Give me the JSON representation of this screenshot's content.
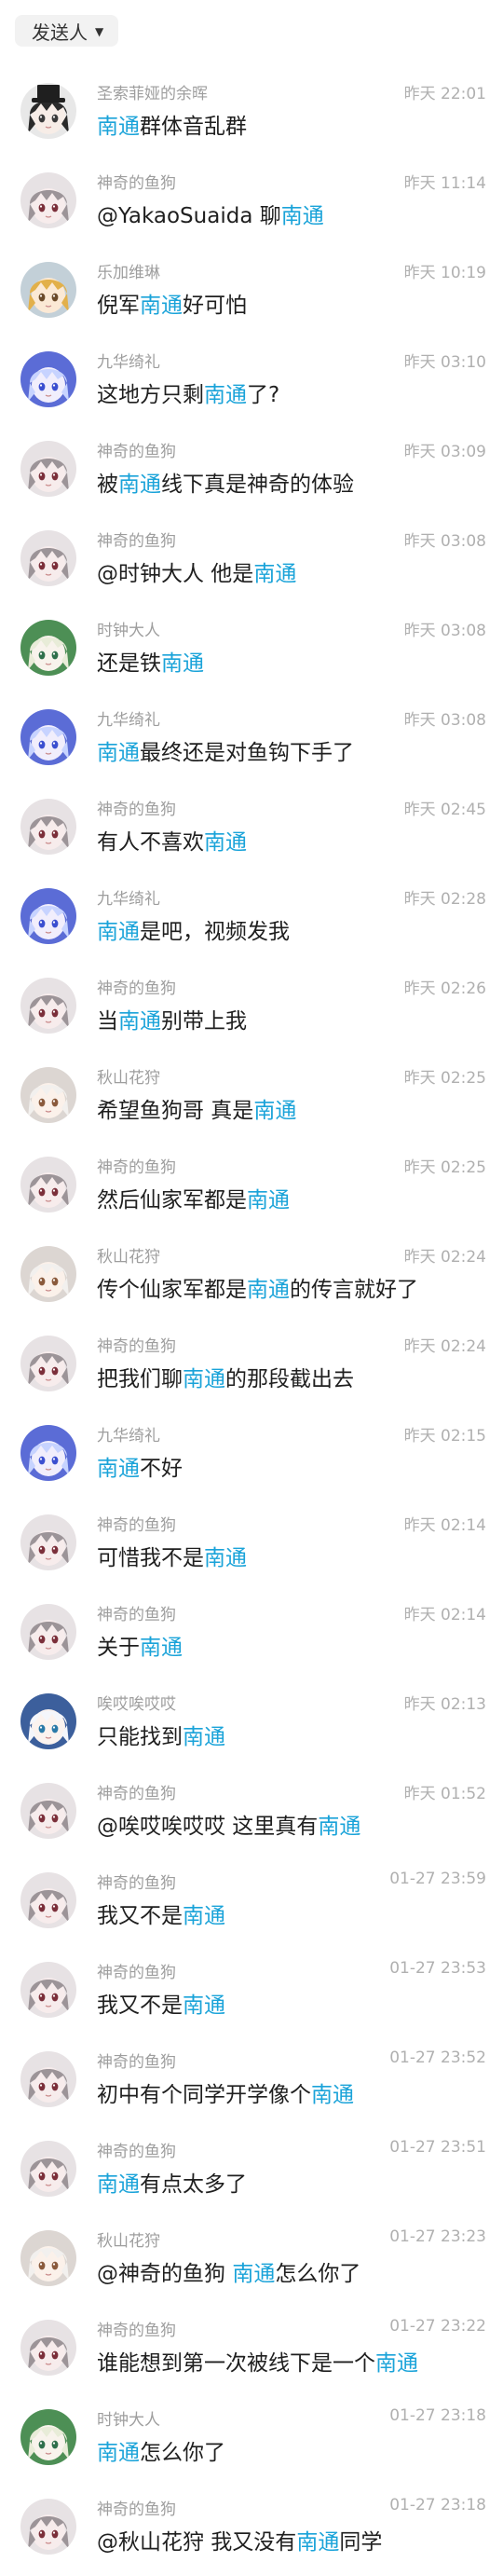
{
  "filter": {
    "label": "发送人",
    "icon": "caret-down-icon"
  },
  "highlight_color": "#1aa3d9",
  "messages": [
    {
      "sender": "圣索菲娅的余晖",
      "time": "昨天 22:01",
      "avatar": "dark",
      "parts": [
        {
          "t": "南通",
          "hl": true
        },
        {
          "t": "群体音乱群"
        }
      ]
    },
    {
      "sender": "神奇的鱼狗",
      "time": "昨天 11:14",
      "avatar": "gray",
      "parts": [
        {
          "t": "@YakaoSuaida 聊"
        },
        {
          "t": "南通",
          "hl": true
        }
      ]
    },
    {
      "sender": "乐加维琳",
      "time": "昨天 10:19",
      "avatar": "gold",
      "parts": [
        {
          "t": "倪军"
        },
        {
          "t": "南通",
          "hl": true
        },
        {
          "t": "好可怕"
        }
      ]
    },
    {
      "sender": "九华绮礼",
      "time": "昨天 03:10",
      "avatar": "blue",
      "parts": [
        {
          "t": "这地方只剩"
        },
        {
          "t": "南通",
          "hl": true
        },
        {
          "t": "了?"
        }
      ]
    },
    {
      "sender": "神奇的鱼狗",
      "time": "昨天 03:09",
      "avatar": "gray",
      "parts": [
        {
          "t": "被"
        },
        {
          "t": "南通",
          "hl": true
        },
        {
          "t": "线下真是神奇的体验"
        }
      ]
    },
    {
      "sender": "神奇的鱼狗",
      "time": "昨天 03:08",
      "avatar": "gray",
      "parts": [
        {
          "t": "@时钟大人 他是"
        },
        {
          "t": "南通",
          "hl": true
        }
      ]
    },
    {
      "sender": "时钟大人",
      "time": "昨天 03:08",
      "avatar": "green",
      "parts": [
        {
          "t": "还是铁"
        },
        {
          "t": "南通",
          "hl": true
        }
      ]
    },
    {
      "sender": "九华绮礼",
      "time": "昨天 03:08",
      "avatar": "blue",
      "parts": [
        {
          "t": "南通",
          "hl": true
        },
        {
          "t": "最终还是对鱼钩下手了"
        }
      ]
    },
    {
      "sender": "神奇的鱼狗",
      "time": "昨天 02:45",
      "avatar": "gray",
      "parts": [
        {
          "t": "有人不喜欢"
        },
        {
          "t": "南通",
          "hl": true
        }
      ]
    },
    {
      "sender": "九华绮礼",
      "time": "昨天 02:28",
      "avatar": "blue",
      "parts": [
        {
          "t": "南通",
          "hl": true
        },
        {
          "t": "是吧，视频发我"
        }
      ]
    },
    {
      "sender": "神奇的鱼狗",
      "time": "昨天 02:26",
      "avatar": "gray",
      "parts": [
        {
          "t": "当"
        },
        {
          "t": "南通",
          "hl": true
        },
        {
          "t": "别带上我"
        }
      ]
    },
    {
      "sender": "秋山花狩",
      "time": "昨天 02:25",
      "avatar": "silver",
      "parts": [
        {
          "t": "希望鱼狗哥 真是"
        },
        {
          "t": "南通",
          "hl": true
        }
      ]
    },
    {
      "sender": "神奇的鱼狗",
      "time": "昨天 02:25",
      "avatar": "gray",
      "parts": [
        {
          "t": "然后仙家军都是"
        },
        {
          "t": "南通",
          "hl": true
        }
      ]
    },
    {
      "sender": "秋山花狩",
      "time": "昨天 02:24",
      "avatar": "silver",
      "parts": [
        {
          "t": "传个仙家军都是"
        },
        {
          "t": "南通",
          "hl": true
        },
        {
          "t": "的传言就好了"
        }
      ]
    },
    {
      "sender": "神奇的鱼狗",
      "time": "昨天 02:24",
      "avatar": "gray",
      "parts": [
        {
          "t": "把我们聊"
        },
        {
          "t": "南通",
          "hl": true
        },
        {
          "t": "的那段截出去"
        }
      ]
    },
    {
      "sender": "九华绮礼",
      "time": "昨天 02:15",
      "avatar": "blue",
      "parts": [
        {
          "t": "南通",
          "hl": true
        },
        {
          "t": "不好"
        }
      ]
    },
    {
      "sender": "神奇的鱼狗",
      "time": "昨天 02:14",
      "avatar": "gray",
      "parts": [
        {
          "t": "可惜我不是"
        },
        {
          "t": "南通",
          "hl": true
        }
      ]
    },
    {
      "sender": "神奇的鱼狗",
      "time": "昨天 02:14",
      "avatar": "gray",
      "parts": [
        {
          "t": "关于"
        },
        {
          "t": "南通",
          "hl": true
        }
      ]
    },
    {
      "sender": "唉哎唉哎哎",
      "time": "昨天 02:13",
      "avatar": "white",
      "parts": [
        {
          "t": "只能找到"
        },
        {
          "t": "南通",
          "hl": true
        }
      ]
    },
    {
      "sender": "神奇的鱼狗",
      "time": "昨天 01:52",
      "avatar": "gray",
      "parts": [
        {
          "t": "@唉哎唉哎哎 这里真有"
        },
        {
          "t": "南通",
          "hl": true
        }
      ]
    },
    {
      "sender": "神奇的鱼狗",
      "time": "01-27 23:59",
      "avatar": "gray",
      "parts": [
        {
          "t": "我又不是"
        },
        {
          "t": "南通",
          "hl": true
        }
      ]
    },
    {
      "sender": "神奇的鱼狗",
      "time": "01-27 23:53",
      "avatar": "gray",
      "parts": [
        {
          "t": "我又不是"
        },
        {
          "t": "南通",
          "hl": true
        }
      ]
    },
    {
      "sender": "神奇的鱼狗",
      "time": "01-27 23:52",
      "avatar": "gray",
      "parts": [
        {
          "t": "初中有个同学开学像个"
        },
        {
          "t": "南通",
          "hl": true
        }
      ]
    },
    {
      "sender": "神奇的鱼狗",
      "time": "01-27 23:51",
      "avatar": "gray",
      "parts": [
        {
          "t": "南通",
          "hl": true
        },
        {
          "t": "有点太多了"
        }
      ]
    },
    {
      "sender": "秋山花狩",
      "time": "01-27 23:23",
      "avatar": "silver",
      "parts": [
        {
          "t": "@神奇的鱼狗 "
        },
        {
          "t": "南通",
          "hl": true
        },
        {
          "t": "怎么你了"
        }
      ]
    },
    {
      "sender": "神奇的鱼狗",
      "time": "01-27 23:22",
      "avatar": "gray",
      "parts": [
        {
          "t": "谁能想到第一次被线下是一个"
        },
        {
          "t": "南通",
          "hl": true
        }
      ]
    },
    {
      "sender": "时钟大人",
      "time": "01-27 23:18",
      "avatar": "green",
      "parts": [
        {
          "t": "南通",
          "hl": true
        },
        {
          "t": "怎么你了"
        }
      ]
    },
    {
      "sender": "神奇的鱼狗",
      "time": "01-27 23:18",
      "avatar": "gray",
      "parts": [
        {
          "t": "@秋山花狩 我又没有"
        },
        {
          "t": "南通",
          "hl": true
        },
        {
          "t": "同学"
        }
      ]
    }
  ]
}
